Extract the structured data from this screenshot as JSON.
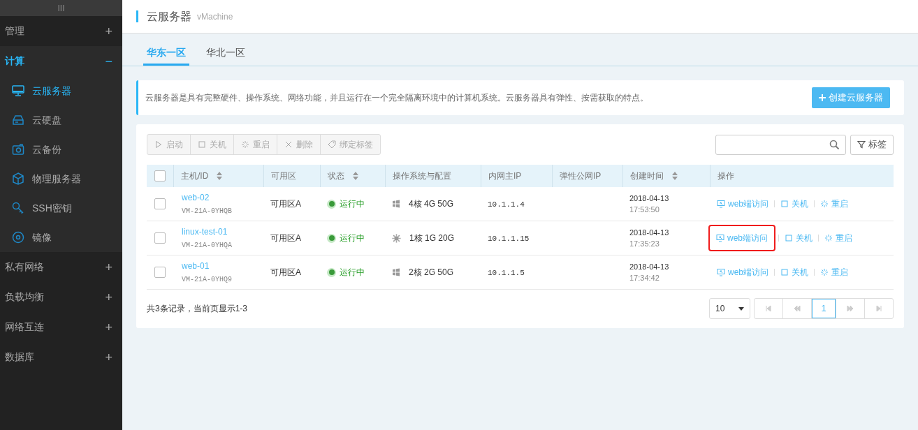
{
  "sidebar": {
    "handle": "III",
    "groups": [
      {
        "label": "管理",
        "selected": false,
        "toggle": "+"
      },
      {
        "label": "计算",
        "selected": true,
        "toggle": "−",
        "items": [
          {
            "label": "云服务器",
            "kind": "monitor",
            "selected": true
          },
          {
            "label": "云硬盘",
            "kind": "disk",
            "selected": false
          },
          {
            "label": "云备份",
            "kind": "camera",
            "selected": false
          },
          {
            "label": "物理服务器",
            "kind": "cube",
            "selected": false
          },
          {
            "label": "SSH密钥",
            "kind": "key",
            "selected": false
          },
          {
            "label": "镜像",
            "kind": "disc",
            "selected": false
          }
        ]
      },
      {
        "label": "私有网络",
        "selected": false,
        "toggle": "+"
      },
      {
        "label": "负载均衡",
        "selected": false,
        "toggle": "+"
      },
      {
        "label": "网络互连",
        "selected": false,
        "toggle": "+"
      },
      {
        "label": "数据库",
        "selected": false,
        "toggle": "+"
      }
    ]
  },
  "header": {
    "title": "云服务器",
    "subtitle": "vMachine"
  },
  "tabs": [
    {
      "label": "华东一区",
      "selected": true
    },
    {
      "label": "华北一区",
      "selected": false
    }
  ],
  "notice": {
    "text": "云服务器是具有完整硬件、操作系统、网络功能，并且运行在一个完全隔离环境中的计算机系统。云服务器具有弹性、按需获取的特点。",
    "create_button": "创建云服务器"
  },
  "toolbar": {
    "buttons": [
      {
        "label": "启动",
        "kind": "play"
      },
      {
        "label": "关机",
        "kind": "square"
      },
      {
        "label": "重启",
        "kind": "spark"
      },
      {
        "label": "删除",
        "kind": "x"
      },
      {
        "label": "绑定标签",
        "kind": "tag"
      }
    ],
    "tag_filter": "标签"
  },
  "table": {
    "select_all_checked": false,
    "columns": [
      {
        "label": "主机/ID",
        "sortable": true
      },
      {
        "label": "可用区",
        "sortable": false
      },
      {
        "label": "状态",
        "sortable": true
      },
      {
        "label": "操作系统与配置",
        "sortable": false
      },
      {
        "label": "内网主IP",
        "sortable": false
      },
      {
        "label": "弹性公网IP",
        "sortable": false
      },
      {
        "label": "创建时间",
        "sortable": true
      },
      {
        "label": "操作",
        "sortable": false
      }
    ],
    "rows": [
      {
        "checked": false,
        "name": "web-02",
        "id": "VM-21A-0YHQB",
        "zone": "可用区A",
        "status": "运行中",
        "os": {
          "kind": "windows",
          "config": "4核 4G 50G"
        },
        "ip": "10.1.1.4",
        "date": "2018-04-13",
        "time": "17:53:50",
        "actions": [
          {
            "label": "web端访问",
            "kind": "web",
            "highlighted": false
          },
          {
            "label": "关机",
            "kind": "square",
            "highlighted": false
          },
          {
            "label": "重启",
            "kind": "spark",
            "highlighted": false
          }
        ]
      },
      {
        "checked": false,
        "name": "linux-test-01",
        "id": "VM-21A-0YHQA",
        "zone": "可用区A",
        "status": "运行中",
        "os": {
          "kind": "linux",
          "config": "1核 1G 20G"
        },
        "ip": "10.1.1.15",
        "date": "2018-04-13",
        "time": "17:35:23",
        "actions": [
          {
            "label": "web端访问",
            "kind": "web",
            "highlighted": true
          },
          {
            "label": "关机",
            "kind": "square",
            "highlighted": false
          },
          {
            "label": "重启",
            "kind": "spark",
            "highlighted": false
          }
        ]
      },
      {
        "checked": false,
        "name": "web-01",
        "id": "VM-21A-0YHQ9",
        "zone": "可用区A",
        "status": "运行中",
        "os": {
          "kind": "windows",
          "config": "2核 2G 50G"
        },
        "ip": "10.1.1.5",
        "date": "2018-04-13",
        "time": "17:34:42",
        "actions": [
          {
            "label": "web端访问",
            "kind": "web",
            "highlighted": false
          },
          {
            "label": "关机",
            "kind": "square",
            "highlighted": false
          },
          {
            "label": "重启",
            "kind": "spark",
            "highlighted": false
          }
        ]
      }
    ]
  },
  "footer": {
    "summary": "共3条记录，当前页显示1-3",
    "page_size": "10",
    "pages": [
      {
        "label": "1",
        "selected": true
      }
    ]
  }
}
